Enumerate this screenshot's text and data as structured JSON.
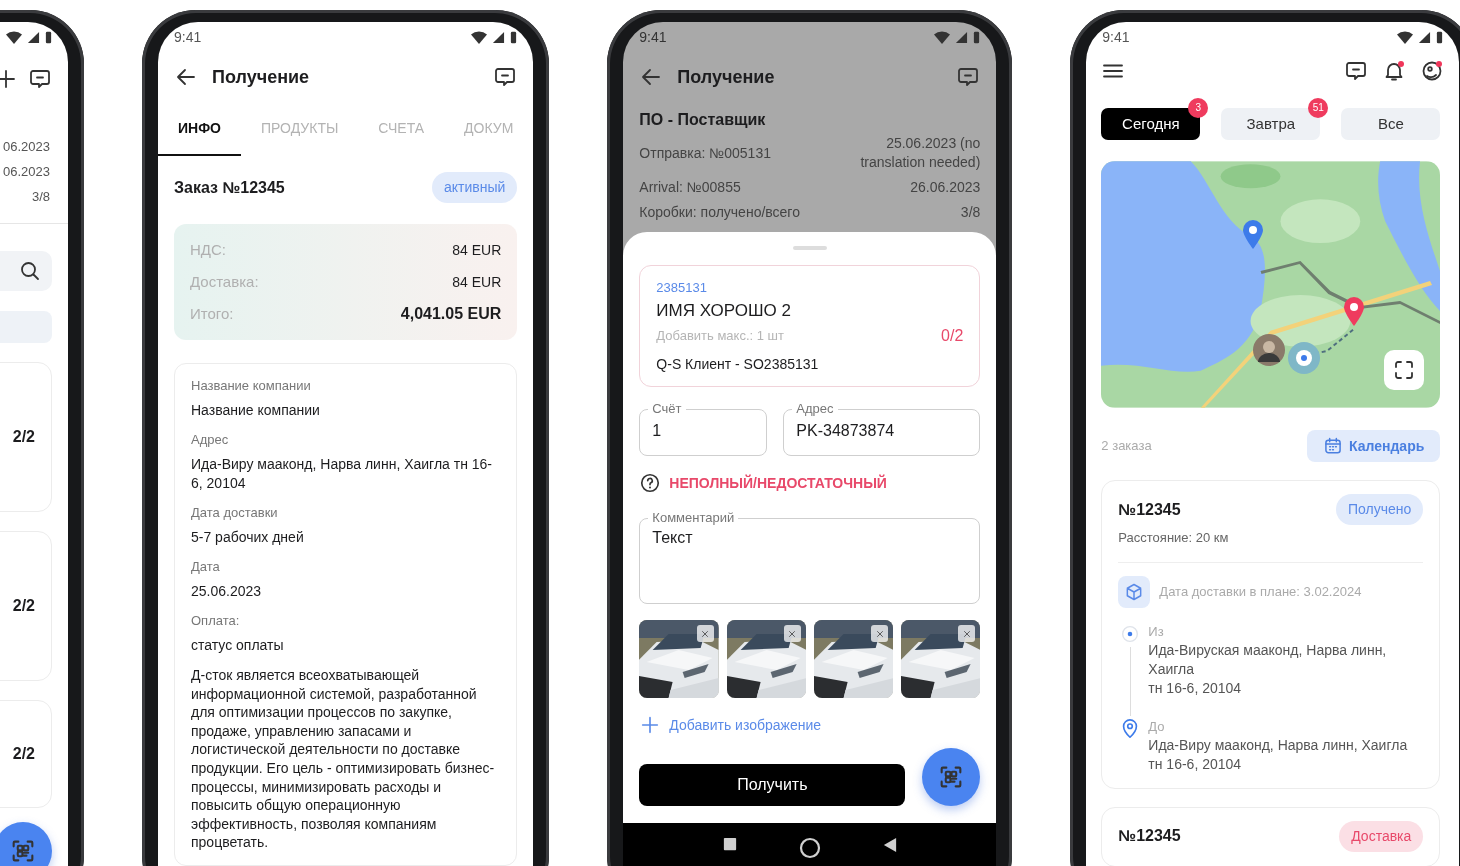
{
  "list_screen": {
    "header_icons": [
      {
        "kind": "plus"
      },
      {
        "kind": "chat"
      }
    ],
    "info_values": [
      "06.2023",
      "06.2023",
      "3/8"
    ],
    "cards": [
      {
        "count": "2/2"
      },
      {
        "count": "2/2"
      },
      {
        "count": "2/2"
      }
    ]
  },
  "info_screen": {
    "status_bar": {
      "time": "9:41"
    },
    "title": "Получение",
    "tabs": [
      {
        "label": "ИНФО",
        "selected": true
      },
      {
        "label": "ПРОДУКТЫ",
        "selected": false
      },
      {
        "label": "СЧЕТА",
        "selected": false
      },
      {
        "label": "ДОКУМ",
        "selected": false
      }
    ],
    "order_title": "Заказ №12345",
    "order_status": {
      "label": "активный",
      "kind": "active"
    },
    "totals": [
      {
        "label": "НДС:",
        "value": "84 EUR",
        "kind": "line"
      },
      {
        "label": "Доставка:",
        "value": "84 EUR",
        "kind": "line"
      },
      {
        "label": "Итого:",
        "value": "4,041.05 EUR",
        "kind": "total"
      }
    ],
    "details": [
      {
        "label": "Название компании",
        "value": "Название компании"
      },
      {
        "label": "Адрес",
        "value": "Ида-Виру мааконд, Нарва линн, Хаигла тн 16-6, 20104"
      },
      {
        "label": "Дата доставки",
        "value": "5-7 рабочих дней"
      },
      {
        "label": "Дата",
        "value": "25.06.2023"
      },
      {
        "label": "Оплата:",
        "value": "статус оплаты"
      }
    ],
    "description": "Д-сток является всеохватывающей информационной системой, разработанной для оптимизации процессов по закупке, продаже, управлению запасами и логистической деятельности по доставке продукции. Его цель - оптимизировать бизнес-процессы, минимизировать расходы и повысить общую операционную эффективность, позволяя компаниям процветать."
  },
  "receive_screen": {
    "status_bar": {
      "time": "9:41"
    },
    "title": "Получение",
    "supplier": "ПО - Поставщик",
    "info_rows": [
      {
        "label": "Отправка: №005131",
        "value": "25.06.2023 (no translation needed)"
      },
      {
        "label": "Arrival: №00855",
        "value": "26.06.2023"
      },
      {
        "label": "Коробки: получено/всего",
        "value": "3/8"
      }
    ],
    "item": {
      "code": "2385131",
      "name": "ИМЯ ХОРОШО 2",
      "hint": "Добавить макс.: 1 шт",
      "count": "0/2",
      "complete": false,
      "client": "Q-S Клиент - SO2385131"
    },
    "fields": [
      {
        "label": "Счёт",
        "value": "1"
      },
      {
        "label": "Адрес",
        "value": "PK-34873874"
      }
    ],
    "warning": "НЕПОЛНЫЙ/НЕДОСТАТОЧНЫЙ",
    "comment": {
      "label": "Комментарий",
      "value": "Текст"
    },
    "add_image": "Добавить изображение",
    "submit": "Получить"
  },
  "orders_screen": {
    "status_bar": {
      "time": "9:41"
    },
    "header_icons": [
      {
        "kind": "chat",
        "unread": false
      },
      {
        "kind": "bell",
        "unread": true
      },
      {
        "kind": "profile",
        "unread": true
      }
    ],
    "tabs": [
      {
        "label": "Сегодня",
        "selected": true,
        "badge": "3"
      },
      {
        "label": "Завтра",
        "selected": false,
        "badge": "51"
      },
      {
        "label": "Все",
        "selected": false
      }
    ],
    "orders_count": "2 заказа",
    "calendar_button": "Календарь",
    "orders": [
      {
        "number": "№12345",
        "status": "Получено",
        "kind": "received",
        "distance": "Расстояние: 20 км",
        "planned_date": "Дата доставки в плане: 3.02.2024",
        "from_label": "Из",
        "from": "Ида-Вируская мааконд, Нарва линн,\nХаигла\nтн 16-6, 20104",
        "to_label": "До",
        "to": "Ида-Виру мааконд, Нарва линн, Хаигла\nтн 16-6, 20104"
      },
      {
        "number": "№12345",
        "status": "Доставка",
        "kind": "delivery"
      }
    ]
  }
}
